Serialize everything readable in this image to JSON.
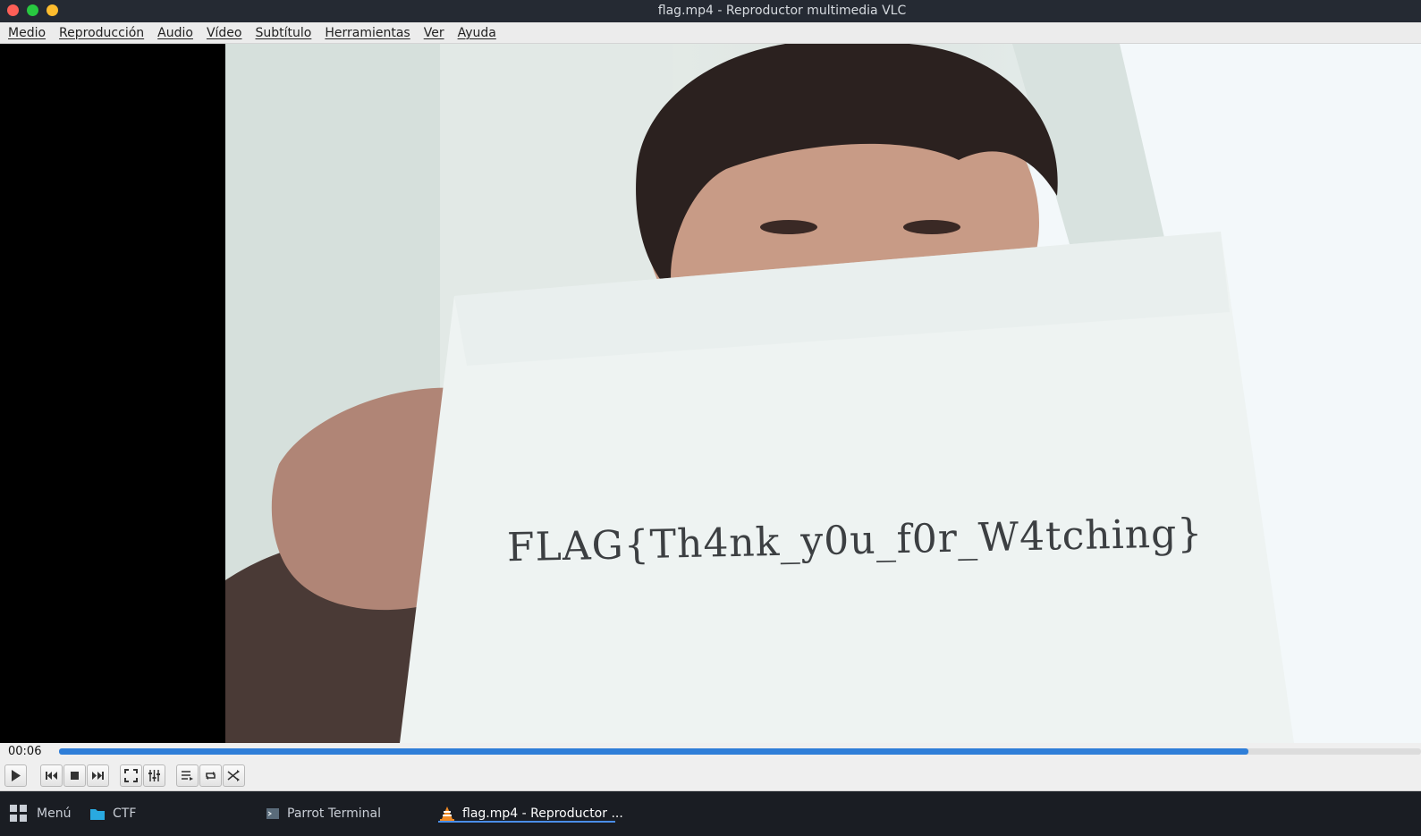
{
  "window": {
    "title": "flag.mp4 - Reproductor multimedia VLC"
  },
  "menubar": {
    "items": [
      "Medio",
      "Reproducción",
      "Audio",
      "Vídeo",
      "Subtítulo",
      "Herramientas",
      "Ver",
      "Ayuda"
    ]
  },
  "video": {
    "sign_text": "FLAG{Th4nk_y0u_f0r_W4tching}"
  },
  "playback": {
    "elapsed": "00:06",
    "progress_fraction": 0.873
  },
  "controls": {
    "buttons": [
      "play-icon",
      "previous-icon",
      "stop-icon",
      "next-icon",
      "fullscreen-icon",
      "extended-settings-icon",
      "playlist-icon",
      "loop-icon",
      "shuffle-icon"
    ]
  },
  "taskbar": {
    "menu_label": "Menú",
    "items": [
      {
        "label": "CTF",
        "icon": "folder-icon"
      },
      {
        "label": "Parrot Terminal",
        "icon": "terminal-icon"
      },
      {
        "label": "flag.mp4 - Reproductor ...",
        "icon": "vlc-cone-icon"
      }
    ]
  },
  "colors": {
    "accent": "#2f7ed8",
    "taskbar": "#1a1d23",
    "titlebar": "#252a33"
  }
}
